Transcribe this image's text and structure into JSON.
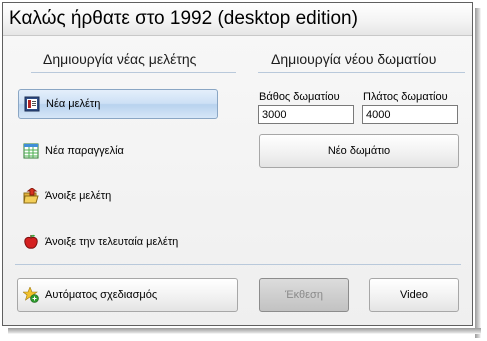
{
  "window": {
    "title": "Καλώς ήρθατε στο 1992 (desktop edition)"
  },
  "left_section": {
    "title": "Δημιουργία νέας μελέτης",
    "items": [
      {
        "label": "Νέα μελέτη",
        "icon": "new-study-icon",
        "selected": true
      },
      {
        "label": "Νέα παραγγελία",
        "icon": "new-order-icon",
        "selected": false
      },
      {
        "label": "Άνοιξε μελέτη",
        "icon": "open-folder-icon",
        "selected": false
      },
      {
        "label": "Άνοιξε την τελευταία μελέτη",
        "icon": "apple-icon",
        "selected": false
      }
    ]
  },
  "right_section": {
    "title": "Δημιουργία νέου δωματίου",
    "depth_label": "Βάθος δωματίου",
    "depth_value": "3000",
    "width_label": "Πλάτος δωματίου",
    "width_value": "4000",
    "new_room_button": "Νέο δωμάτιο"
  },
  "bottom": {
    "auto_design_label": "Αυτόματος σχεδιασμός",
    "auto_design_icon": "star-plus-icon",
    "report_label": "Έκθεση",
    "report_enabled": false,
    "video_label": "Video"
  },
  "colors": {
    "selected_top": "#e4effb",
    "selected_bottom": "#b8d2ee",
    "divider": "#b9c9db"
  }
}
